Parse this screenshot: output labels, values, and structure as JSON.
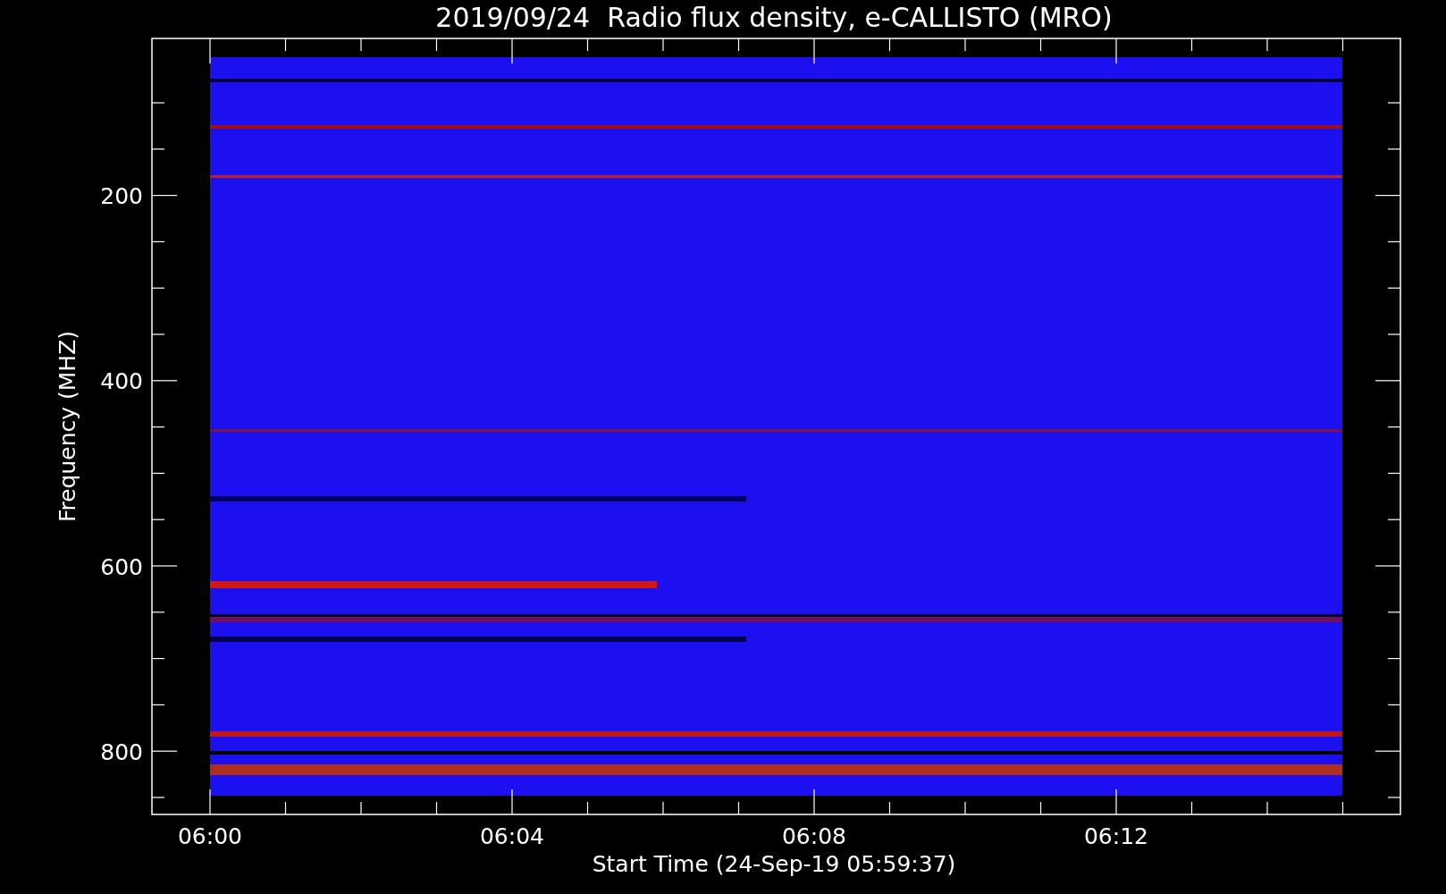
{
  "title": "2019/09/24  Radio flux density, e-CALLISTO (MRO)",
  "y_axis": {
    "label": "Frequency (MHZ)",
    "ticks": [
      "200",
      "400",
      "600",
      "800"
    ]
  },
  "x_axis": {
    "label": "Start Time (24-Sep-19 05:59:37)",
    "ticks": [
      "06:00",
      "06:04",
      "06:08",
      "06:12"
    ]
  }
}
